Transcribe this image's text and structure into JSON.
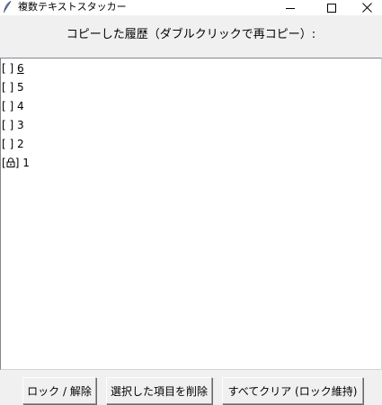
{
  "window": {
    "title": "複数テキストスタッカー",
    "app_icon": "feather-icon",
    "controls": [
      "minimize-icon",
      "maximize-icon",
      "close-icon"
    ]
  },
  "header": {
    "label": "コピーした履歴（ダブルクリックで再コピー）:"
  },
  "history": {
    "items": [
      {
        "prefix": "[ ]",
        "text": "6",
        "locked": false,
        "active": true
      },
      {
        "prefix": "[ ]",
        "text": "5",
        "locked": false,
        "active": false
      },
      {
        "prefix": "[ ]",
        "text": "4",
        "locked": false,
        "active": false
      },
      {
        "prefix": "[ ]",
        "text": "3",
        "locked": false,
        "active": false
      },
      {
        "prefix": "[ ]",
        "text": "2",
        "locked": false,
        "active": false
      },
      {
        "prefix_open": "[",
        "prefix_close": "]",
        "text": "1",
        "locked": true,
        "active": false
      }
    ]
  },
  "buttons": {
    "lock_label": "ロック / 解除",
    "delete_label": "選択した項目を削除",
    "clear_label": "すべてクリア (ロック維持)"
  }
}
